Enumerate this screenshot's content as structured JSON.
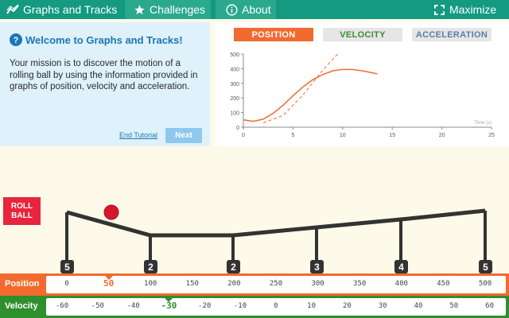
{
  "topbar": {
    "app_title": "Graphs and Tracks",
    "challenges_label": "Challenges",
    "about_label": "About",
    "maximize_label": "Maximize"
  },
  "tutorial": {
    "title": "Welcome to Graphs and Tracks!",
    "body": "Your mission is to discover the motion of a rolling ball by using the information provided in graphs of position, velocity and acceleration.",
    "end_label": "End Tutorial",
    "next_label": "Next"
  },
  "graph": {
    "tabs": [
      "POSITION",
      "VELOCITY",
      "ACCELERATION"
    ],
    "active_tab": "POSITION",
    "x_label": "Time (s)",
    "y_ticks": [
      "500",
      "400",
      "300",
      "200",
      "100",
      "0"
    ],
    "x_ticks": [
      "0",
      "5",
      "10",
      "15",
      "20",
      "25"
    ]
  },
  "chart_data": {
    "type": "line",
    "xlim": [
      0,
      25
    ],
    "ylim": [
      0,
      500
    ],
    "xlabel": "Time (s)",
    "series": [
      {
        "style": "solid",
        "color": "#f26a2e",
        "x": [
          0,
          1,
          2,
          3,
          4,
          5,
          6,
          7,
          8,
          9,
          10,
          11,
          12,
          13.5
        ],
        "y": [
          50,
          40,
          55,
          95,
          150,
          215,
          275,
          325,
          360,
          385,
          395,
          395,
          385,
          365
        ]
      },
      {
        "style": "dashed",
        "color": "#f26a2e",
        "x": [
          2,
          4,
          6,
          8,
          9.5
        ],
        "y": [
          30,
          80,
          220,
          390,
          500
        ]
      }
    ]
  },
  "track": {
    "roll_label_1": "ROLL",
    "roll_label_2": "BALL",
    "posts": [
      "5",
      "2",
      "2",
      "3",
      "4",
      "5"
    ],
    "ball_color": "#d6182c"
  },
  "position_ruler": {
    "label": "Position",
    "values": [
      "0",
      "50",
      "100",
      "150",
      "200",
      "250",
      "300",
      "350",
      "400",
      "450",
      "500"
    ],
    "selected_index": 1
  },
  "velocity_ruler": {
    "label": "Velocity",
    "values": [
      "-60",
      "-50",
      "-40",
      "-30",
      "-20",
      "-10",
      "0",
      "10",
      "20",
      "30",
      "40",
      "50",
      "60"
    ],
    "selected_index": 3
  }
}
